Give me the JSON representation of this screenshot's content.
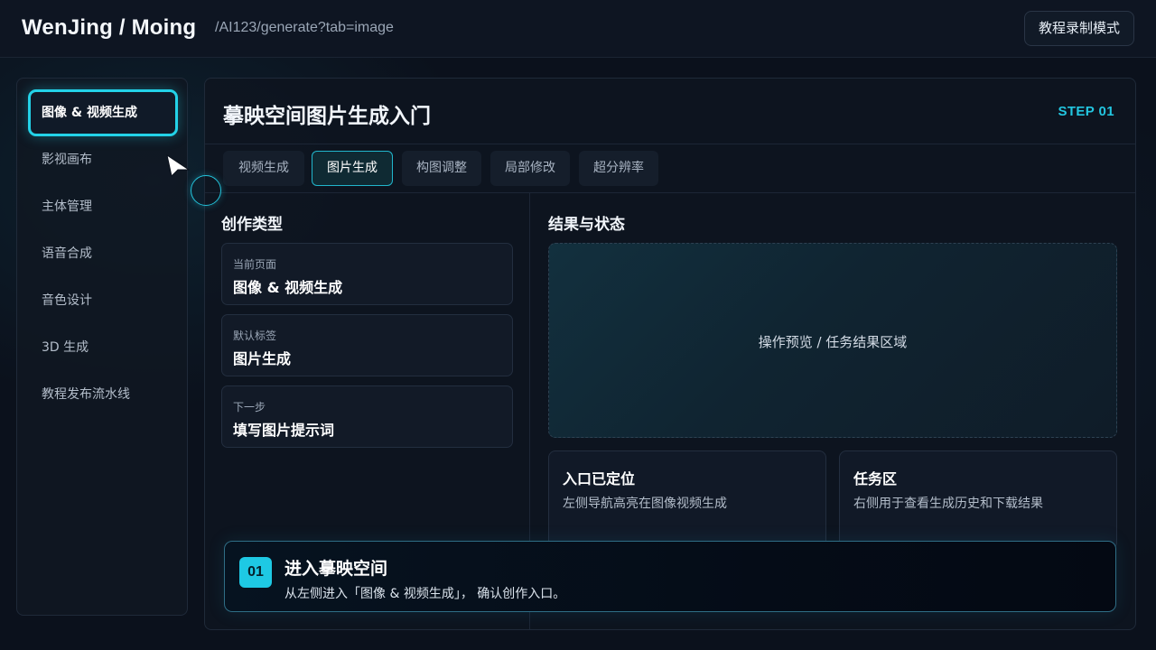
{
  "header": {
    "brand": "WenJing / Moing",
    "route": "/AI123/generate?tab=image",
    "mode_button": "教程录制模式"
  },
  "sidebar": {
    "items": [
      {
        "label": "图像 & 视频生成",
        "active": true
      },
      {
        "label": "影视画布",
        "active": false
      },
      {
        "label": "主体管理",
        "active": false
      },
      {
        "label": "语音合成",
        "active": false
      },
      {
        "label": "音色设计",
        "active": false
      },
      {
        "label": "3D 生成",
        "active": false
      },
      {
        "label": "教程发布流水线",
        "active": false
      }
    ]
  },
  "main": {
    "title": "摹映空间图片生成入门",
    "step": "STEP 01",
    "tabs": [
      {
        "label": "视频生成",
        "active": false
      },
      {
        "label": "图片生成",
        "active": true
      },
      {
        "label": "构图调整",
        "active": false
      },
      {
        "label": "局部修改",
        "active": false
      },
      {
        "label": "超分辨率",
        "active": false
      }
    ],
    "left": {
      "title": "创作类型",
      "cards": [
        {
          "key": "当前页面",
          "value": "图像 & 视频生成"
        },
        {
          "key": "默认标签",
          "value": "图片生成"
        },
        {
          "key": "下一步",
          "value": "填写图片提示词"
        }
      ]
    },
    "right": {
      "title": "结果与状态",
      "preview_text": "操作预览 / 任务结果区域",
      "status_cards": [
        {
          "title": "入口已定位",
          "desc": "左侧导航高亮在图像视频生成"
        },
        {
          "title": "任务区",
          "desc": "右侧用于查看生成历史和下载结果"
        }
      ]
    }
  },
  "toast": {
    "number": "01",
    "title": "进入摹映空间",
    "desc": "从左侧进入「图像 & 视频生成」， 确认创作入口。"
  },
  "colors": {
    "accent": "#23d2e8",
    "background": "#0b111c",
    "panel": "#0e1520"
  },
  "icons": {
    "cursor": "pointer-arrow-icon",
    "click_ring": "click-indicator-icon"
  }
}
